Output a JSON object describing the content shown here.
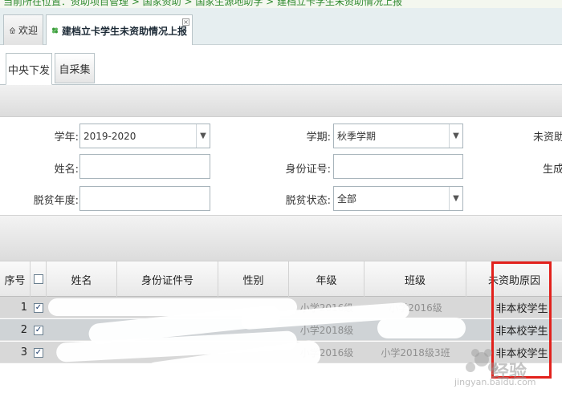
{
  "breadcrumb": "当前所在位置：资助项目管理 > 国家资助 > 国家生源地助学 > 建档立卡学生未资助情况上报",
  "main_tabs": [
    {
      "label": "欢迎"
    },
    {
      "label": "建档立卡学生未资助情况上报"
    }
  ],
  "sub_tabs": [
    {
      "label": "中央下发"
    },
    {
      "label": "自采集"
    }
  ],
  "form": {
    "school_year_label": "学年:",
    "school_year_value": "2019-2020",
    "semester_label": "学期:",
    "semester_value": "秋季学期",
    "right_label_1": "未资助",
    "name_label": "姓名:",
    "name_value": "",
    "id_label": "身份证号:",
    "id_value": "",
    "right_label_2": "生成",
    "poverty_year_label": "脱贫年度:",
    "poverty_year_value": "",
    "poverty_status_label": "脱贫状态:",
    "poverty_status_value": "全部"
  },
  "table": {
    "columns": [
      "序号",
      "姓名",
      "身份证件号",
      "性别",
      "年级",
      "班级",
      "未资助原因"
    ],
    "rows": [
      {
        "index": "1",
        "checked": true,
        "name": "",
        "id": "",
        "gender": "",
        "grade": "小学2016级",
        "class": "小学2016级",
        "reason": "非本校学生"
      },
      {
        "index": "2",
        "checked": true,
        "name": "",
        "id": "",
        "gender": "",
        "grade": "小学2018级",
        "class": "",
        "reason": "非本校学生"
      },
      {
        "index": "3",
        "checked": true,
        "name": "",
        "id": "",
        "gender": "",
        "grade": "小学2016级",
        "class": "小学2018级3班",
        "reason": "非本校学生"
      }
    ]
  },
  "watermark": {
    "text": "经验",
    "url": "jingyan.baidu.com"
  },
  "colors": {
    "annotation": "#e2211c",
    "tab_bg": "#e6eef0",
    "row_bg": "#d8d8d8"
  }
}
